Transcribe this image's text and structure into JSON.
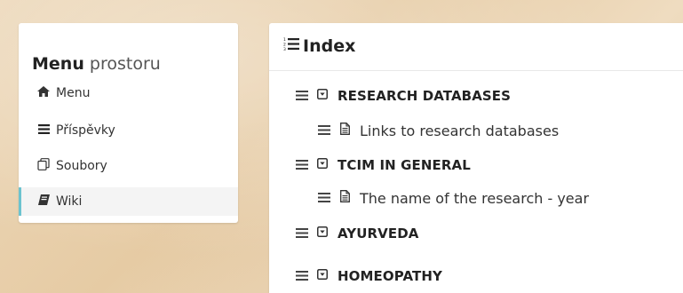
{
  "sidebar": {
    "title_strong": "Menu",
    "title_light": "prostoru",
    "items": [
      {
        "icon": "home-icon",
        "glyph": "🏠︎",
        "label": "Menu",
        "active": false
      },
      {
        "icon": "list-icon",
        "glyph": "☰",
        "label": "Příspěvky",
        "active": false
      },
      {
        "icon": "files-icon",
        "glyph": "🗐",
        "label": "Soubory",
        "active": false
      },
      {
        "icon": "book-icon",
        "glyph": "📘︎",
        "label": "Wiki",
        "active": true
      }
    ]
  },
  "index": {
    "title": "Index",
    "title_icon": "ordered-list-icon",
    "tree": [
      {
        "type": "category",
        "label": "RESEARCH DATABASES"
      },
      {
        "type": "page",
        "label": "Links to research databases"
      },
      {
        "type": "category",
        "label": "TCIM IN GENERAL"
      },
      {
        "type": "page",
        "label": "The name of the research - year"
      },
      {
        "type": "category",
        "label": "AYURVEDA"
      },
      {
        "type": "category",
        "label": "HOMEOPATHY"
      }
    ]
  },
  "colors": {
    "active_accent": "#6cc3cf",
    "active_bg": "#f4f4f4"
  }
}
